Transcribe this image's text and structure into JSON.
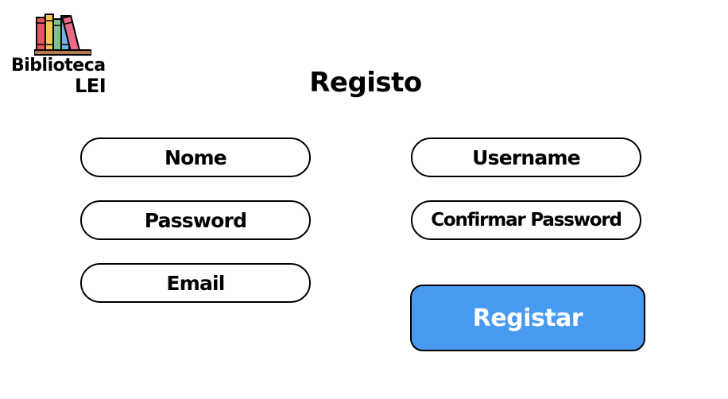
{
  "logo": {
    "line1": "Biblioteca",
    "line2": "LEI",
    "icon": "books-icon"
  },
  "page": {
    "title": "Registo"
  },
  "form": {
    "nome": {
      "placeholder": "Nome",
      "value": ""
    },
    "password": {
      "placeholder": "Password",
      "value": ""
    },
    "email": {
      "placeholder": "Email",
      "value": ""
    },
    "username": {
      "placeholder": "Username",
      "value": ""
    },
    "confirm_password": {
      "placeholder": "Confirmar Password",
      "value": ""
    },
    "submit_label": "Registar"
  },
  "colors": {
    "submit_bg": "#4899f0",
    "border": "#000000",
    "background": "#ffffff"
  }
}
